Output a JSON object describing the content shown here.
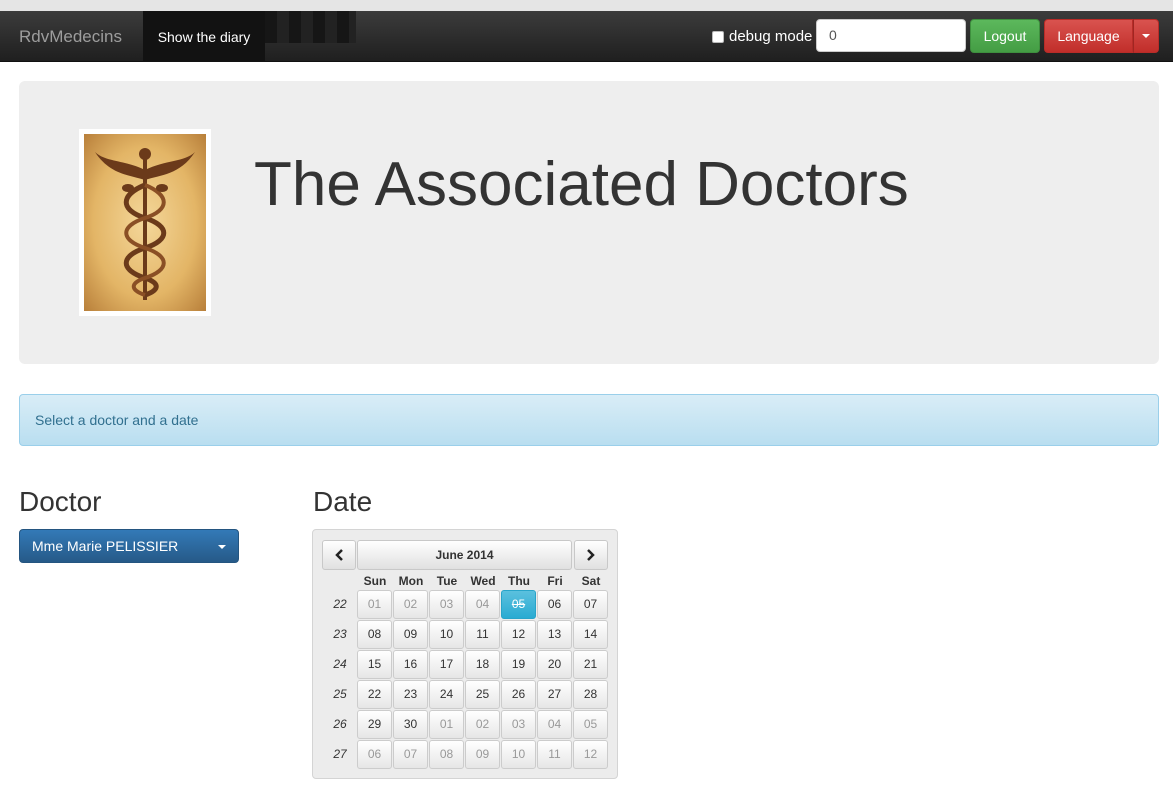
{
  "navbar": {
    "brand": "RdvMedecins",
    "active_link": "Show the diary",
    "debug_label": "debug mode",
    "input_value": "0",
    "logout_label": "Logout",
    "language_label": "Language"
  },
  "jumbotron": {
    "title": "The Associated Doctors"
  },
  "alert": {
    "message": "Select a doctor and a date"
  },
  "doctor": {
    "heading": "Doctor",
    "selected": "Mme Marie PELISSIER"
  },
  "calendar": {
    "heading": "Date",
    "month_label": "June 2014",
    "days_of_week": [
      "Sun",
      "Mon",
      "Tue",
      "Wed",
      "Thu",
      "Fri",
      "Sat"
    ],
    "weeks": [
      {
        "week": "22",
        "days": [
          {
            "d": "01",
            "m": true
          },
          {
            "d": "02",
            "m": true
          },
          {
            "d": "03",
            "m": true
          },
          {
            "d": "04",
            "m": true
          },
          {
            "d": "05",
            "a": true
          },
          {
            "d": "06"
          },
          {
            "d": "07"
          }
        ]
      },
      {
        "week": "23",
        "days": [
          {
            "d": "08"
          },
          {
            "d": "09"
          },
          {
            "d": "10"
          },
          {
            "d": "11"
          },
          {
            "d": "12"
          },
          {
            "d": "13"
          },
          {
            "d": "14"
          }
        ]
      },
      {
        "week": "24",
        "days": [
          {
            "d": "15"
          },
          {
            "d": "16"
          },
          {
            "d": "17"
          },
          {
            "d": "18"
          },
          {
            "d": "19"
          },
          {
            "d": "20"
          },
          {
            "d": "21"
          }
        ]
      },
      {
        "week": "25",
        "days": [
          {
            "d": "22"
          },
          {
            "d": "23"
          },
          {
            "d": "24"
          },
          {
            "d": "25"
          },
          {
            "d": "26"
          },
          {
            "d": "27"
          },
          {
            "d": "28"
          }
        ]
      },
      {
        "week": "26",
        "days": [
          {
            "d": "29"
          },
          {
            "d": "30"
          },
          {
            "d": "01",
            "m": true
          },
          {
            "d": "02",
            "m": true
          },
          {
            "d": "03",
            "m": true
          },
          {
            "d": "04",
            "m": true
          },
          {
            "d": "05",
            "m": true
          }
        ]
      },
      {
        "week": "27",
        "days": [
          {
            "d": "06",
            "m": true
          },
          {
            "d": "07",
            "m": true
          },
          {
            "d": "08",
            "m": true
          },
          {
            "d": "09",
            "m": true
          },
          {
            "d": "10",
            "m": true
          },
          {
            "d": "11",
            "m": true
          },
          {
            "d": "12",
            "m": true
          }
        ]
      }
    ]
  }
}
